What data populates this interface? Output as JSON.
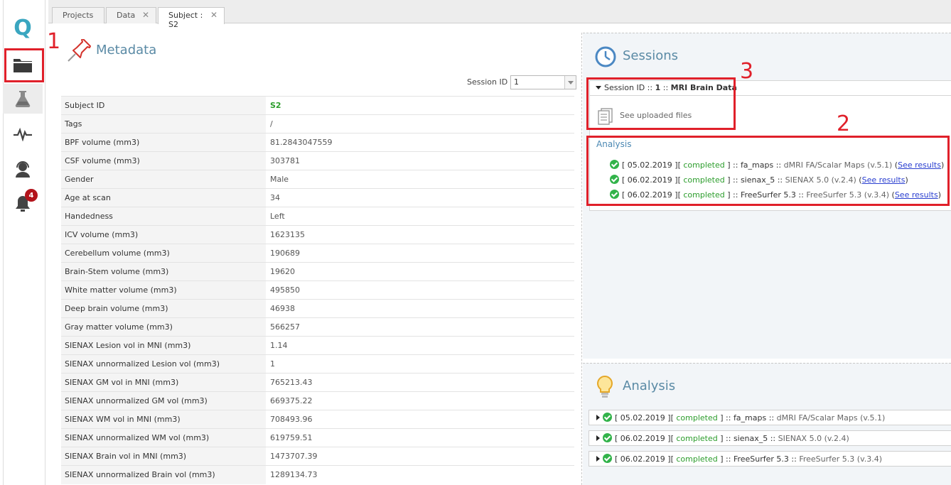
{
  "rail": {
    "badge_count": "4",
    "logo_letter": "Q",
    "icons": [
      "folder-icon",
      "flask-icon",
      "pulse-icon",
      "support-agent-icon",
      "bell-icon"
    ]
  },
  "annotations": {
    "c1": "1",
    "c2": "2",
    "c3": "3"
  },
  "tabs": [
    {
      "label": "Projects"
    },
    {
      "label": "Data",
      "close": "✕"
    },
    {
      "label": "Subject : S2",
      "close": "✕"
    }
  ],
  "metadata": {
    "title": "Metadata",
    "session_label": "Session ID",
    "session_value": "1",
    "rows": [
      {
        "key": "Subject ID",
        "value": "S2"
      },
      {
        "key": "Tags",
        "value": "/"
      },
      {
        "key": "BPF volume (mm3)",
        "value": "81.2843047559"
      },
      {
        "key": "CSF volume (mm3)",
        "value": "303781"
      },
      {
        "key": "Gender",
        "value": "Male"
      },
      {
        "key": "Age at scan",
        "value": "34"
      },
      {
        "key": "Handedness",
        "value": "Left"
      },
      {
        "key": "ICV volume (mm3)",
        "value": "1623135"
      },
      {
        "key": "Cerebellum volume (mm3)",
        "value": "190689"
      },
      {
        "key": "Brain-Stem volume (mm3)",
        "value": "19620"
      },
      {
        "key": "White matter volume (mm3)",
        "value": "495850"
      },
      {
        "key": "Deep brain volume (mm3)",
        "value": "46938"
      },
      {
        "key": "Gray matter volume (mm3)",
        "value": "566257"
      },
      {
        "key": "SIENAX Lesion vol in MNI (mm3)",
        "value": "1.14"
      },
      {
        "key": "SIENAX unnormalized Lesion vol (mm3)",
        "value": "1"
      },
      {
        "key": "SIENAX GM vol in MNI (mm3)",
        "value": "765213.43"
      },
      {
        "key": "SIENAX unnormalized GM vol (mm3)",
        "value": "669375.22"
      },
      {
        "key": "SIENAX WM vol in MNI (mm3)",
        "value": "708493.96"
      },
      {
        "key": "SIENAX unnormalized WM vol (mm3)",
        "value": "619759.51"
      },
      {
        "key": "SIENAX Brain vol in MNI (mm3)",
        "value": "1473707.39"
      },
      {
        "key": "SIENAX unnormalized Brain vol (mm3)",
        "value": "1289134.73"
      }
    ]
  },
  "sessions": {
    "title": "Sessions",
    "header_prefix": "Session ID :: ",
    "header_id": "1",
    "header_sep": " :: ",
    "header_name": "MRI Brain Data",
    "uploaded_label": "See uploaded files",
    "analysis_label": "Analysis",
    "analyses": [
      {
        "date": "05.02.2019",
        "status": "completed",
        "name": "fa_maps",
        "tool": "dMRI FA/Scalar Maps (v.5.1)",
        "link": "See results"
      },
      {
        "date": "06.02.2019",
        "status": "completed",
        "name": "sienax_5",
        "tool": "SIENAX 5.0 (v.2.4)",
        "link": "See results"
      },
      {
        "date": "06.02.2019",
        "status": "completed",
        "name": "FreeSurfer 5.3",
        "tool": "FreeSurfer 5.3 (v.3.4)",
        "link": "See results"
      }
    ]
  },
  "analysis_panel": {
    "title": "Analysis",
    "items": [
      {
        "date": "05.02.2019",
        "status": "completed",
        "name": "fa_maps",
        "tool": "dMRI FA/Scalar Maps (v.5.1)"
      },
      {
        "date": "06.02.2019",
        "status": "completed",
        "name": "sienax_5",
        "tool": "SIENAX 5.0 (v.2.4)"
      },
      {
        "date": "06.02.2019",
        "status": "completed",
        "name": "FreeSurfer 5.3",
        "tool": "FreeSurfer 5.3 (v.3.4)"
      }
    ]
  },
  "colors": {
    "accent": "#5a8aa5",
    "status_green": "#2c9d2c",
    "annotation_red": "#e0202a",
    "badge_red": "#b3141c"
  }
}
